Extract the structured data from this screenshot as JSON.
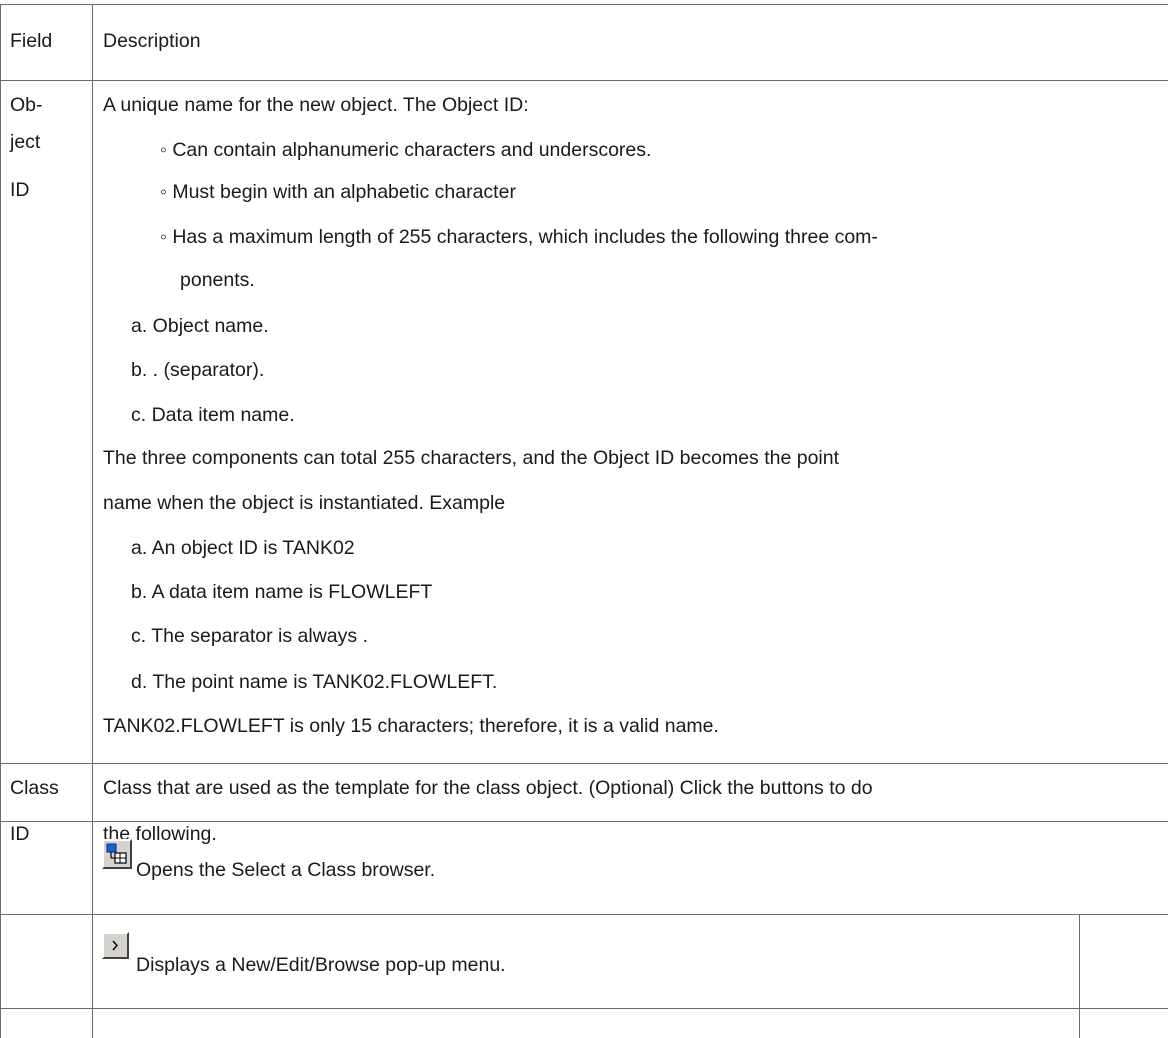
{
  "table": {
    "header": {
      "field": "Field",
      "description": "Description"
    },
    "object_id_row": {
      "field_lines": [
        "Ob-",
        "ject",
        "ID"
      ],
      "intro": "A unique name for the new object. The Object ID:",
      "bullets": [
        "◦ Can contain alphanumeric characters and underscores.",
        "◦ Must begin with an alphabetic character",
        "◦ Has a maximum length of 255 characters, which  includes the following three com-",
        "ponents."
      ],
      "components": [
        "a. Object name.",
        "b. . (separator).",
        "c. Data item name."
      ],
      "paragraph_lines": [
        "The three components can total 255 characters, and the Object ID becomes the point",
        "name when the object is instantiated. Example"
      ],
      "example_steps": [
        "a. An object ID is TANK02",
        "b. A data item name is FLOWLEFT",
        "c. The separator is always .",
        "d. The point name is TANK02.FLOWLEFT."
      ],
      "conclusion": "TANK02.FLOWLEFT is only 15 characters; therefore, it is a valid name."
    },
    "class_id_row": {
      "field_lines": [
        "Class",
        "ID"
      ],
      "description_lines": [
        "Class that are used as the template for the class object. (Optional) Click the buttons to do",
        "the following."
      ]
    },
    "button_rows": [
      {
        "icon": "class-browser-icon",
        "text": "Opens the Select a Class browser."
      },
      {
        "icon": "arrow-right-icon",
        "text": "Displays a New/Edit/Browse  pop-up menu."
      }
    ]
  }
}
